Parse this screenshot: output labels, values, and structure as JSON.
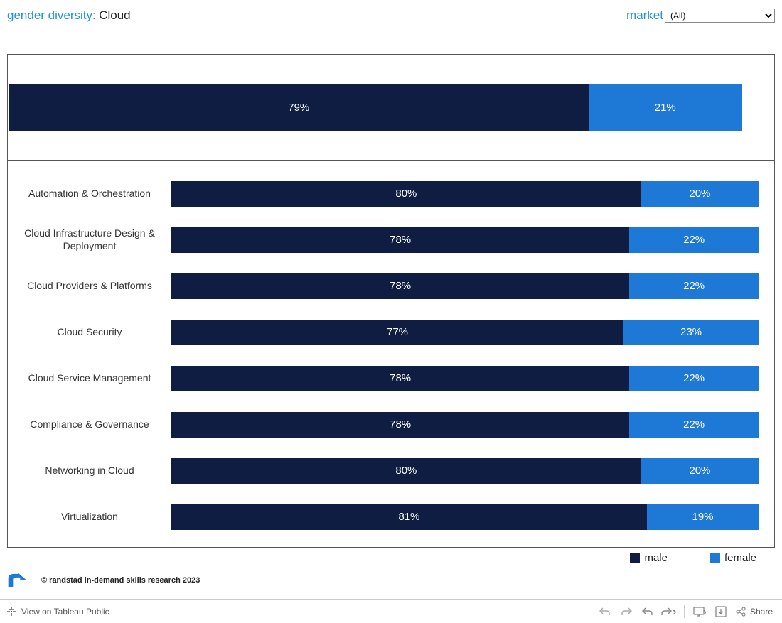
{
  "header": {
    "title_label": "gender diversity:",
    "title_value": "Cloud",
    "market_label": "market",
    "market_selected": "(All)"
  },
  "summary": {
    "male_pct": 79,
    "female_pct": 21
  },
  "legend": {
    "male": "male",
    "female": "female"
  },
  "credit": "© randstad in-demand skills research 2023",
  "toolbar": {
    "view_label": "View on Tableau Public",
    "share_label": "Share"
  },
  "colors": {
    "male": "#0f1d42",
    "female": "#1e78d6"
  },
  "chart_data": {
    "type": "bar",
    "orientation": "horizontal",
    "stacked": true,
    "unit": "%",
    "title": "gender diversity: Cloud",
    "overall": {
      "male": 79,
      "female": 21
    },
    "categories": [
      "Automation & Orchestration",
      "Cloud Infrastructure Design & Deployment",
      "Cloud Providers & Platforms",
      "Cloud Security",
      "Cloud Service Management",
      "Compliance & Governance",
      "Networking in Cloud",
      "Virtualization"
    ],
    "series": [
      {
        "name": "male",
        "values": [
          80,
          78,
          78,
          77,
          78,
          78,
          80,
          81
        ]
      },
      {
        "name": "female",
        "values": [
          20,
          22,
          22,
          23,
          22,
          22,
          20,
          19
        ]
      }
    ]
  }
}
